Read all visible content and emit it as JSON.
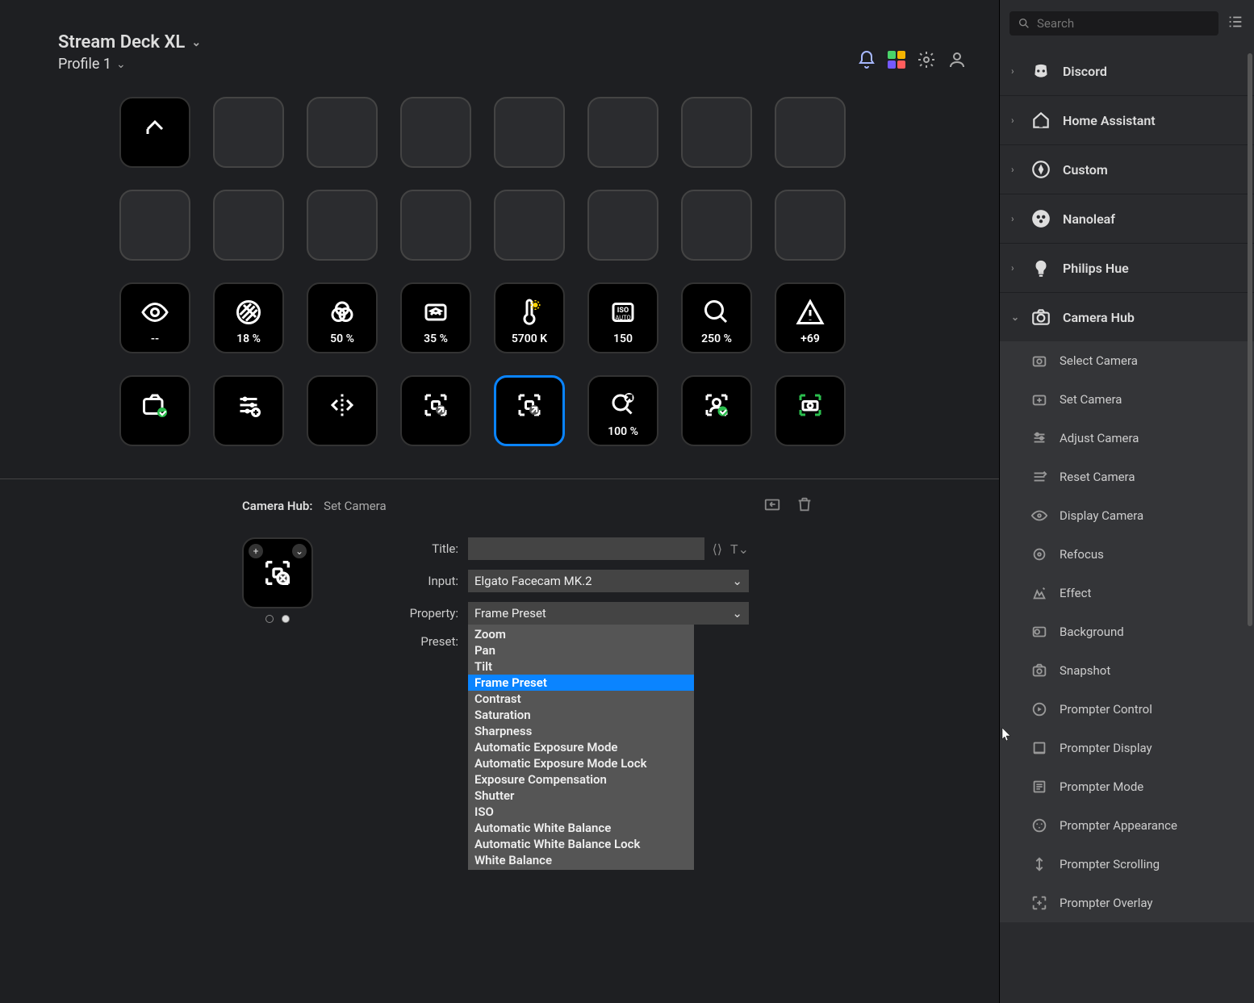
{
  "header": {
    "device": "Stream Deck XL",
    "profile": "Profile 1"
  },
  "keys": [
    {
      "icon": "back",
      "label": "",
      "style": "black"
    },
    {
      "style": "blank"
    },
    {
      "style": "blank"
    },
    {
      "style": "blank"
    },
    {
      "style": "blank"
    },
    {
      "style": "blank"
    },
    {
      "style": "blank"
    },
    {
      "style": "blank"
    },
    {
      "style": "blank"
    },
    {
      "style": "blank"
    },
    {
      "style": "blank"
    },
    {
      "style": "blank"
    },
    {
      "style": "blank"
    },
    {
      "style": "blank"
    },
    {
      "style": "blank"
    },
    {
      "style": "blank"
    },
    {
      "icon": "eye",
      "label": "--",
      "style": "black"
    },
    {
      "icon": "contrast",
      "label": "18 %",
      "style": "black"
    },
    {
      "icon": "venn",
      "label": "50 %",
      "style": "black"
    },
    {
      "icon": "sharp",
      "label": "35 %",
      "style": "black"
    },
    {
      "icon": "temp",
      "label": "5700 K",
      "style": "black"
    },
    {
      "icon": "iso",
      "label": "150",
      "style": "black"
    },
    {
      "icon": "zoom",
      "label": "250 %",
      "style": "black"
    },
    {
      "icon": "warn",
      "label": "+69",
      "style": "black"
    },
    {
      "icon": "camcheck",
      "label": "",
      "style": "black"
    },
    {
      "icon": "sliders",
      "label": "",
      "style": "black"
    },
    {
      "icon": "mirror",
      "label": "",
      "style": "black"
    },
    {
      "icon": "framearrow",
      "label": "",
      "style": "black"
    },
    {
      "icon": "framearrow",
      "label": "",
      "style": "black",
      "selected": true
    },
    {
      "icon": "zoomarrow",
      "label": "100 %",
      "style": "black"
    },
    {
      "icon": "personcheck",
      "label": "",
      "style": "black"
    },
    {
      "icon": "money",
      "label": "",
      "style": "black"
    }
  ],
  "inspector": {
    "module": "Camera Hub:",
    "action": "Set Camera",
    "fields": {
      "title_label": "Title:",
      "title_value": "",
      "input_label": "Input:",
      "input_value": "Elgato Facecam MK.2",
      "property_label": "Property:",
      "property_value": "Frame Preset",
      "preset_label": "Preset:"
    },
    "dropdown_options": [
      "Zoom",
      "Pan",
      "Tilt",
      "Frame Preset",
      "Contrast",
      "Saturation",
      "Sharpness",
      "Automatic Exposure Mode",
      "Automatic Exposure Mode Lock",
      "Exposure Compensation",
      "Shutter",
      "ISO",
      "Automatic White Balance",
      "Automatic White Balance Lock",
      "White Balance"
    ],
    "dropdown_selected": "Frame Preset"
  },
  "sidebar": {
    "search_placeholder": "Search",
    "categories": [
      {
        "name": "Discord",
        "icon": "discord"
      },
      {
        "name": "Home Assistant",
        "icon": "home"
      },
      {
        "name": "Custom",
        "icon": "custom"
      },
      {
        "name": "Nanoleaf",
        "icon": "nanoleaf"
      },
      {
        "name": "Philips Hue",
        "icon": "bulb"
      },
      {
        "name": "Camera Hub",
        "icon": "camera",
        "open": true
      }
    ],
    "actions": [
      "Select Camera",
      "Set Camera",
      "Adjust Camera",
      "Reset Camera",
      "Display Camera",
      "Refocus",
      "Effect",
      "Background",
      "Snapshot",
      "Prompter Control",
      "Prompter Display",
      "Prompter Mode",
      "Prompter Appearance",
      "Prompter Scrolling",
      "Prompter Overlay"
    ]
  }
}
